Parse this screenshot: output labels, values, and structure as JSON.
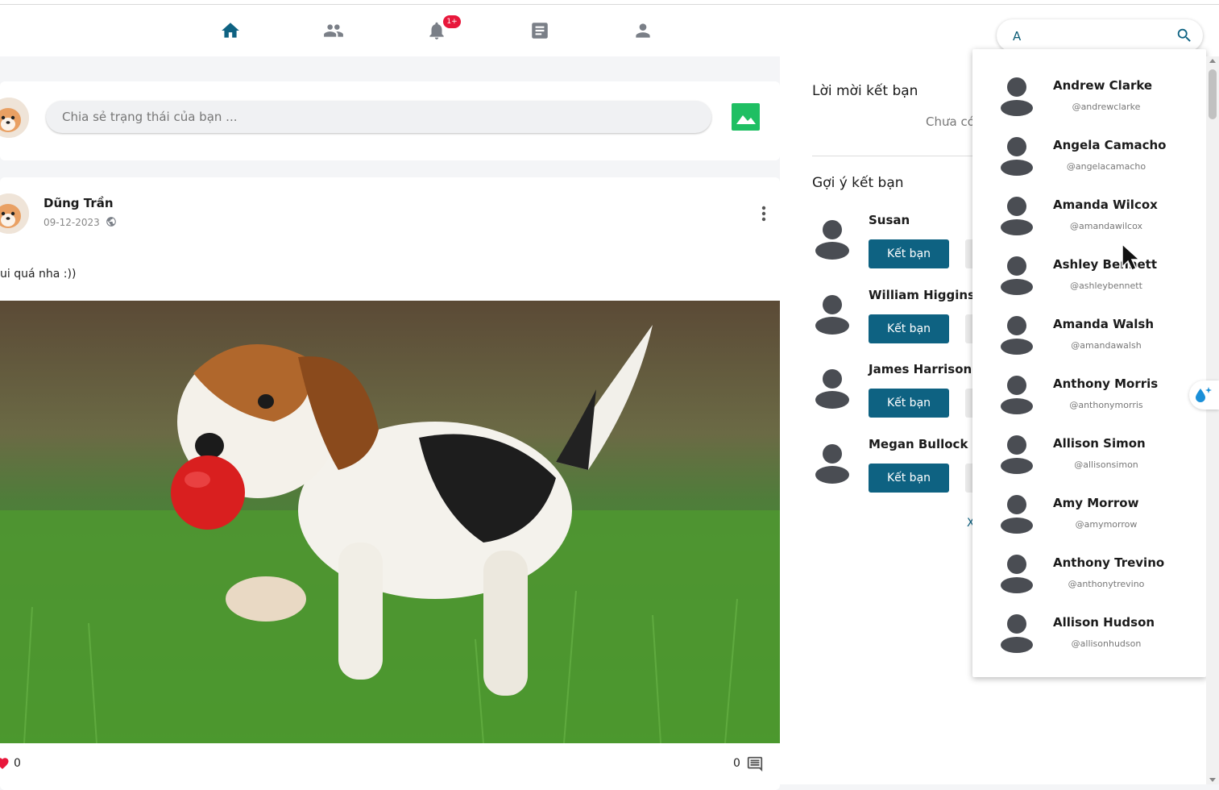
{
  "nav": {
    "items": [
      {
        "name": "home-icon",
        "active": true
      },
      {
        "name": "friends-icon",
        "active": false
      },
      {
        "name": "bell-icon",
        "active": false
      },
      {
        "name": "newsfeed-icon",
        "active": false
      },
      {
        "name": "profile-icon",
        "active": false
      }
    ],
    "notification_badge": "1+",
    "search_value": "A",
    "search_icon": "search-icon"
  },
  "composer": {
    "placeholder": "Chia sẻ trạng thái của bạn ...",
    "image_icon": "image-icon"
  },
  "post": {
    "author": "Dũng Trần",
    "date": "09-12-2023",
    "text": "ui quá nha :))",
    "likes": "0",
    "comments": "0"
  },
  "sidebar": {
    "requests_title": "Lời mời kết bạn",
    "requests_empty": "Chưa có",
    "suggest_title": "Gợi ý kết bạn",
    "add_label": "Kết bạn",
    "suggestions": [
      "Susan",
      "William Higgins",
      "James Harrison",
      "Megan Bullock"
    ],
    "see_more": "X"
  },
  "search_results": [
    {
      "name": "Andrew Clarke",
      "username": "@andrewclarke"
    },
    {
      "name": "Angela Camacho",
      "username": "@angelacamacho"
    },
    {
      "name": "Amanda Wilcox",
      "username": "@amandawilcox"
    },
    {
      "name": "Ashley Bennett",
      "username": "@ashleybennett"
    },
    {
      "name": "Amanda Walsh",
      "username": "@amandawalsh"
    },
    {
      "name": "Anthony Morris",
      "username": "@anthonymorris"
    },
    {
      "name": "Allison Simon",
      "username": "@allisonsimon"
    },
    {
      "name": "Amy Morrow",
      "username": "@amymorrow"
    },
    {
      "name": "Anthony Trevino",
      "username": "@anthonytrevino"
    },
    {
      "name": "Allison Hudson",
      "username": "@allisonhudson"
    }
  ],
  "colors": {
    "accent": "#0e6282",
    "badge": "#e8173b",
    "image_button": "#1fbf63",
    "avatar_gray": "#4a4d53"
  }
}
